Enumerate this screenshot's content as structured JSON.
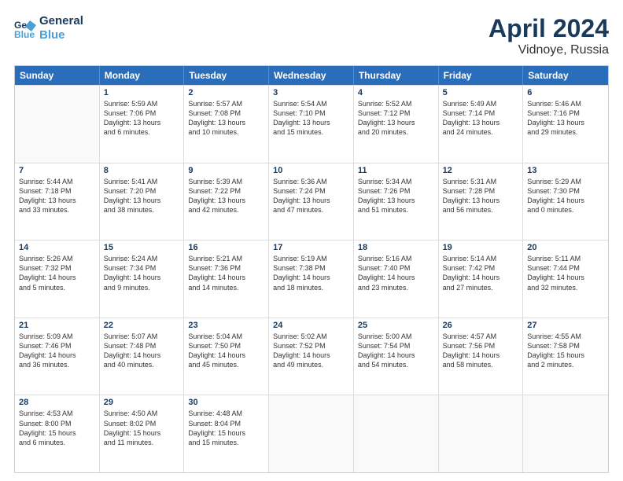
{
  "header": {
    "logo_line1": "General",
    "logo_line2": "Blue",
    "month_year": "April 2024",
    "location": "Vidnoye, Russia"
  },
  "weekdays": [
    "Sunday",
    "Monday",
    "Tuesday",
    "Wednesday",
    "Thursday",
    "Friday",
    "Saturday"
  ],
  "rows": [
    [
      {
        "day": "",
        "lines": []
      },
      {
        "day": "1",
        "lines": [
          "Sunrise: 5:59 AM",
          "Sunset: 7:06 PM",
          "Daylight: 13 hours",
          "and 6 minutes."
        ]
      },
      {
        "day": "2",
        "lines": [
          "Sunrise: 5:57 AM",
          "Sunset: 7:08 PM",
          "Daylight: 13 hours",
          "and 10 minutes."
        ]
      },
      {
        "day": "3",
        "lines": [
          "Sunrise: 5:54 AM",
          "Sunset: 7:10 PM",
          "Daylight: 13 hours",
          "and 15 minutes."
        ]
      },
      {
        "day": "4",
        "lines": [
          "Sunrise: 5:52 AM",
          "Sunset: 7:12 PM",
          "Daylight: 13 hours",
          "and 20 minutes."
        ]
      },
      {
        "day": "5",
        "lines": [
          "Sunrise: 5:49 AM",
          "Sunset: 7:14 PM",
          "Daylight: 13 hours",
          "and 24 minutes."
        ]
      },
      {
        "day": "6",
        "lines": [
          "Sunrise: 5:46 AM",
          "Sunset: 7:16 PM",
          "Daylight: 13 hours",
          "and 29 minutes."
        ]
      }
    ],
    [
      {
        "day": "7",
        "lines": [
          "Sunrise: 5:44 AM",
          "Sunset: 7:18 PM",
          "Daylight: 13 hours",
          "and 33 minutes."
        ]
      },
      {
        "day": "8",
        "lines": [
          "Sunrise: 5:41 AM",
          "Sunset: 7:20 PM",
          "Daylight: 13 hours",
          "and 38 minutes."
        ]
      },
      {
        "day": "9",
        "lines": [
          "Sunrise: 5:39 AM",
          "Sunset: 7:22 PM",
          "Daylight: 13 hours",
          "and 42 minutes."
        ]
      },
      {
        "day": "10",
        "lines": [
          "Sunrise: 5:36 AM",
          "Sunset: 7:24 PM",
          "Daylight: 13 hours",
          "and 47 minutes."
        ]
      },
      {
        "day": "11",
        "lines": [
          "Sunrise: 5:34 AM",
          "Sunset: 7:26 PM",
          "Daylight: 13 hours",
          "and 51 minutes."
        ]
      },
      {
        "day": "12",
        "lines": [
          "Sunrise: 5:31 AM",
          "Sunset: 7:28 PM",
          "Daylight: 13 hours",
          "and 56 minutes."
        ]
      },
      {
        "day": "13",
        "lines": [
          "Sunrise: 5:29 AM",
          "Sunset: 7:30 PM",
          "Daylight: 14 hours",
          "and 0 minutes."
        ]
      }
    ],
    [
      {
        "day": "14",
        "lines": [
          "Sunrise: 5:26 AM",
          "Sunset: 7:32 PM",
          "Daylight: 14 hours",
          "and 5 minutes."
        ]
      },
      {
        "day": "15",
        "lines": [
          "Sunrise: 5:24 AM",
          "Sunset: 7:34 PM",
          "Daylight: 14 hours",
          "and 9 minutes."
        ]
      },
      {
        "day": "16",
        "lines": [
          "Sunrise: 5:21 AM",
          "Sunset: 7:36 PM",
          "Daylight: 14 hours",
          "and 14 minutes."
        ]
      },
      {
        "day": "17",
        "lines": [
          "Sunrise: 5:19 AM",
          "Sunset: 7:38 PM",
          "Daylight: 14 hours",
          "and 18 minutes."
        ]
      },
      {
        "day": "18",
        "lines": [
          "Sunrise: 5:16 AM",
          "Sunset: 7:40 PM",
          "Daylight: 14 hours",
          "and 23 minutes."
        ]
      },
      {
        "day": "19",
        "lines": [
          "Sunrise: 5:14 AM",
          "Sunset: 7:42 PM",
          "Daylight: 14 hours",
          "and 27 minutes."
        ]
      },
      {
        "day": "20",
        "lines": [
          "Sunrise: 5:11 AM",
          "Sunset: 7:44 PM",
          "Daylight: 14 hours",
          "and 32 minutes."
        ]
      }
    ],
    [
      {
        "day": "21",
        "lines": [
          "Sunrise: 5:09 AM",
          "Sunset: 7:46 PM",
          "Daylight: 14 hours",
          "and 36 minutes."
        ]
      },
      {
        "day": "22",
        "lines": [
          "Sunrise: 5:07 AM",
          "Sunset: 7:48 PM",
          "Daylight: 14 hours",
          "and 40 minutes."
        ]
      },
      {
        "day": "23",
        "lines": [
          "Sunrise: 5:04 AM",
          "Sunset: 7:50 PM",
          "Daylight: 14 hours",
          "and 45 minutes."
        ]
      },
      {
        "day": "24",
        "lines": [
          "Sunrise: 5:02 AM",
          "Sunset: 7:52 PM",
          "Daylight: 14 hours",
          "and 49 minutes."
        ]
      },
      {
        "day": "25",
        "lines": [
          "Sunrise: 5:00 AM",
          "Sunset: 7:54 PM",
          "Daylight: 14 hours",
          "and 54 minutes."
        ]
      },
      {
        "day": "26",
        "lines": [
          "Sunrise: 4:57 AM",
          "Sunset: 7:56 PM",
          "Daylight: 14 hours",
          "and 58 minutes."
        ]
      },
      {
        "day": "27",
        "lines": [
          "Sunrise: 4:55 AM",
          "Sunset: 7:58 PM",
          "Daylight: 15 hours",
          "and 2 minutes."
        ]
      }
    ],
    [
      {
        "day": "28",
        "lines": [
          "Sunrise: 4:53 AM",
          "Sunset: 8:00 PM",
          "Daylight: 15 hours",
          "and 6 minutes."
        ]
      },
      {
        "day": "29",
        "lines": [
          "Sunrise: 4:50 AM",
          "Sunset: 8:02 PM",
          "Daylight: 15 hours",
          "and 11 minutes."
        ]
      },
      {
        "day": "30",
        "lines": [
          "Sunrise: 4:48 AM",
          "Sunset: 8:04 PM",
          "Daylight: 15 hours",
          "and 15 minutes."
        ]
      },
      {
        "day": "",
        "lines": []
      },
      {
        "day": "",
        "lines": []
      },
      {
        "day": "",
        "lines": []
      },
      {
        "day": "",
        "lines": []
      }
    ]
  ]
}
